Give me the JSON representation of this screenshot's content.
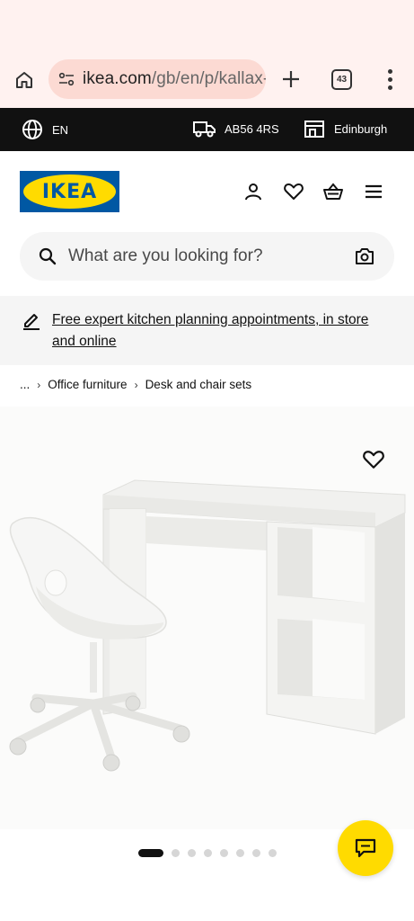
{
  "browser": {
    "url_host": "ikea.com",
    "url_path": "/gb/en/p/kallax-",
    "tab_count": "43"
  },
  "top_bar": {
    "language": "EN",
    "postcode": "AB56 4RS",
    "store": "Edinburgh"
  },
  "header": {
    "logo_text": "IKEA"
  },
  "search": {
    "placeholder": "What are you looking for?"
  },
  "banner": {
    "link_text": "Free expert kitchen planning appointments, in store and online"
  },
  "breadcrumb": {
    "ellipsis": "...",
    "items": [
      "Office furniture",
      "Desk and chair sets"
    ]
  },
  "carousel": {
    "total_images": 8,
    "active_index": 0
  },
  "colors": {
    "brand_blue": "#0058a3",
    "brand_yellow": "#ffdb00",
    "browser_bar": "#fff2f0",
    "url_pill": "#fcdad3",
    "top_strip": "#111111"
  }
}
